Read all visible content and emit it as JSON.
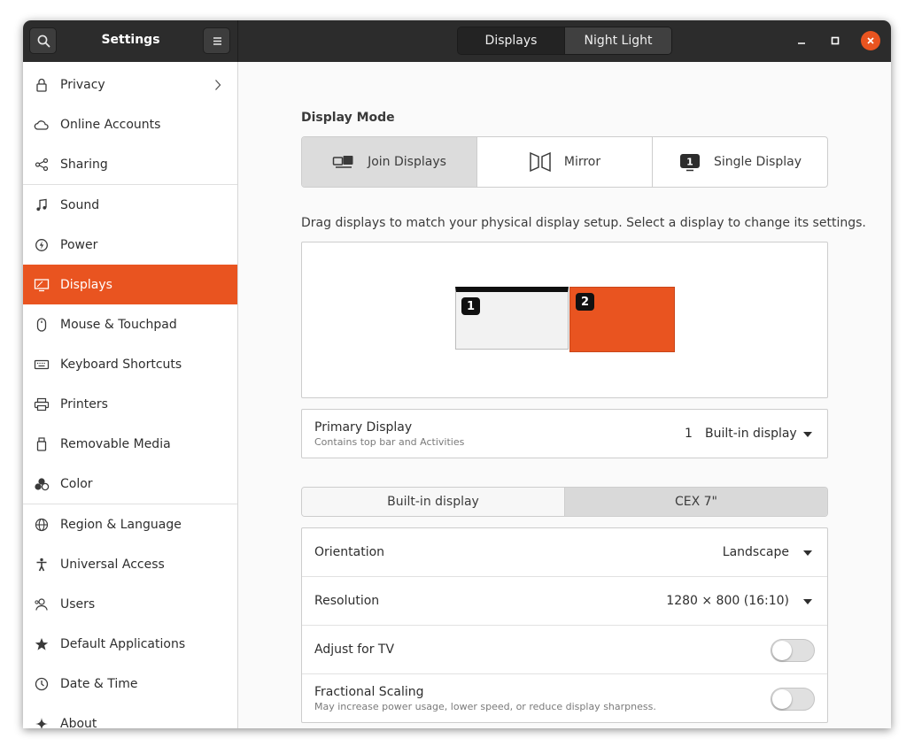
{
  "window": {
    "title": "Settings",
    "view_switcher": {
      "active": "Displays",
      "inactive": "Night Light"
    }
  },
  "sidebar": {
    "items": [
      {
        "label": "Privacy",
        "icon": "lock-icon"
      },
      {
        "label": "Online Accounts",
        "icon": "cloud-icon"
      },
      {
        "label": "Sharing",
        "icon": "share-icon"
      },
      {
        "label": "Sound",
        "icon": "music-note-icon"
      },
      {
        "label": "Power",
        "icon": "power-icon"
      },
      {
        "label": "Displays",
        "icon": "display-icon",
        "active": true
      },
      {
        "label": "Mouse & Touchpad",
        "icon": "mouse-icon"
      },
      {
        "label": "Keyboard Shortcuts",
        "icon": "keyboard-icon"
      },
      {
        "label": "Printers",
        "icon": "printer-icon"
      },
      {
        "label": "Removable Media",
        "icon": "usb-icon"
      },
      {
        "label": "Color",
        "icon": "color-icon"
      },
      {
        "label": "Region & Language",
        "icon": "globe-icon"
      },
      {
        "label": "Universal Access",
        "icon": "accessibility-icon"
      },
      {
        "label": "Users",
        "icon": "users-icon"
      },
      {
        "label": "Default Applications",
        "icon": "star-icon"
      },
      {
        "label": "Date & Time",
        "icon": "clock-icon"
      },
      {
        "label": "About",
        "icon": "sparkle-icon"
      }
    ]
  },
  "main": {
    "display_mode_title": "Display Mode",
    "modes": [
      {
        "label": "Join Displays",
        "selected": true
      },
      {
        "label": "Mirror",
        "selected": false
      },
      {
        "label": "Single Display",
        "selected": false
      }
    ],
    "single_display_badge": "1",
    "arrangement_hint": "Drag displays to match your physical display setup. Select a display to change its settings.",
    "monitors": [
      {
        "number": "1",
        "primary": true
      },
      {
        "number": "2",
        "primary": false
      }
    ],
    "primary_display": {
      "label": "Primary Display",
      "sublabel": "Contains top bar and Activities",
      "number": "1",
      "value": "Built-in display"
    },
    "display_tabs": [
      {
        "label": "Built-in display",
        "selected": true
      },
      {
        "label": "CEX 7\"",
        "selected": false
      }
    ],
    "settings": {
      "orientation": {
        "label": "Orientation",
        "value": "Landscape"
      },
      "resolution": {
        "label": "Resolution",
        "value": "1280 × 800 (16:10)"
      },
      "adjust_tv": {
        "label": "Adjust for TV",
        "enabled": false
      },
      "fractional_scaling": {
        "label": "Fractional Scaling",
        "sublabel": "May increase power usage, lower speed, or reduce display sharpness.",
        "enabled": false
      }
    }
  },
  "colors": {
    "accent": "#e95420",
    "header": "#2c2c2c"
  }
}
